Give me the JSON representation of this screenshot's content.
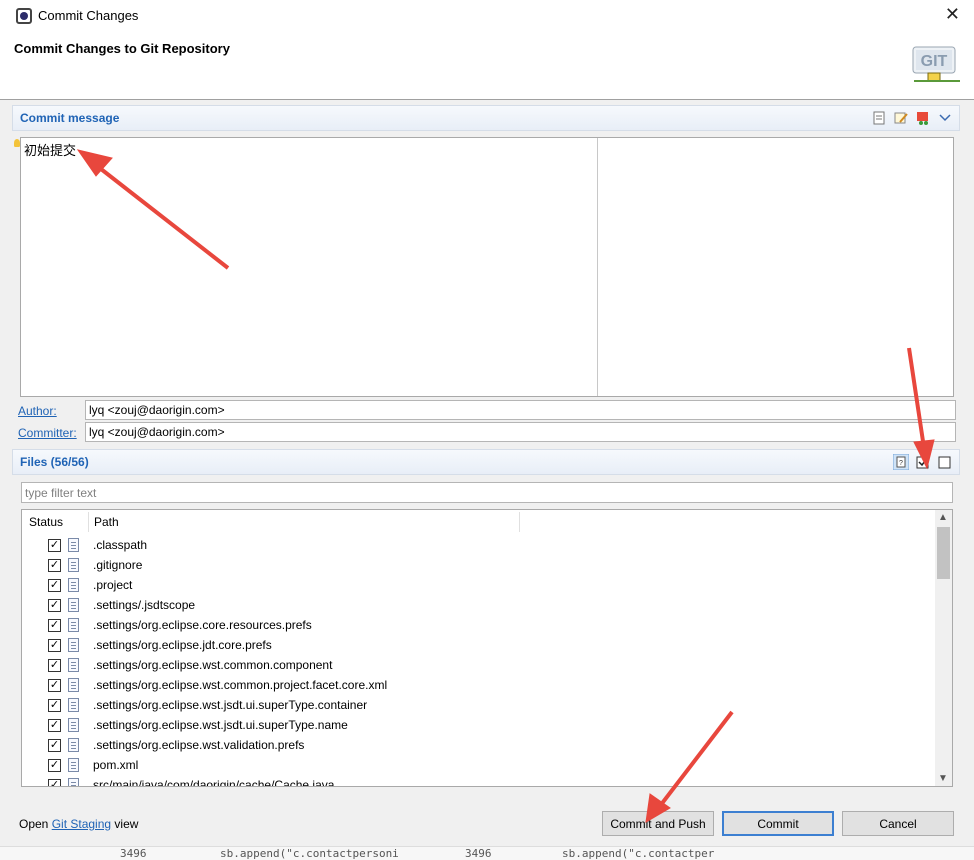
{
  "window": {
    "title": "Commit Changes",
    "close_glyph": "✕"
  },
  "header": {
    "title": "Commit Changes to Git Repository",
    "logo_text": "GIT"
  },
  "commit_message": {
    "section_title": "Commit message",
    "text": "初始提交"
  },
  "author": {
    "label": "Author:",
    "value": "lyq <zouj@daorigin.com>"
  },
  "committer": {
    "label": "Committer:",
    "value": "lyq <zouj@daorigin.com>"
  },
  "files": {
    "section_title": "Files (56/56)",
    "filter_placeholder": "type filter text",
    "columns": [
      "Status",
      "Path"
    ],
    "rows": [
      {
        "path": ".classpath",
        "checked": true
      },
      {
        "path": ".gitignore",
        "checked": true
      },
      {
        "path": ".project",
        "checked": true
      },
      {
        "path": ".settings/.jsdtscope",
        "checked": true
      },
      {
        "path": ".settings/org.eclipse.core.resources.prefs",
        "checked": true
      },
      {
        "path": ".settings/org.eclipse.jdt.core.prefs",
        "checked": true
      },
      {
        "path": ".settings/org.eclipse.wst.common.component",
        "checked": true
      },
      {
        "path": ".settings/org.eclipse.wst.common.project.facet.core.xml",
        "checked": true
      },
      {
        "path": ".settings/org.eclipse.wst.jsdt.ui.superType.container",
        "checked": true
      },
      {
        "path": ".settings/org.eclipse.wst.jsdt.ui.superType.name",
        "checked": true
      },
      {
        "path": ".settings/org.eclipse.wst.validation.prefs",
        "checked": true
      },
      {
        "path": "pom.xml",
        "checked": true
      },
      {
        "path": "src/main/java/com/daorigin/cache/Cache.java",
        "checked": true
      }
    ]
  },
  "footer": {
    "open_text": "Open",
    "link_text": "Git Staging",
    "view_text": "view",
    "buttons": {
      "commit_and_push": "Commit and Push",
      "commit": "Commit",
      "cancel": "Cancel"
    }
  },
  "background_editor": {
    "left_line": "3496",
    "left_code": "sb.append(\"c.contactpersoni",
    "right_line": "3496",
    "right_code": "sb.append(\"c.contactper"
  },
  "colors": {
    "accent": "#1f63b5",
    "annotation_arrow": "#e8473d"
  }
}
